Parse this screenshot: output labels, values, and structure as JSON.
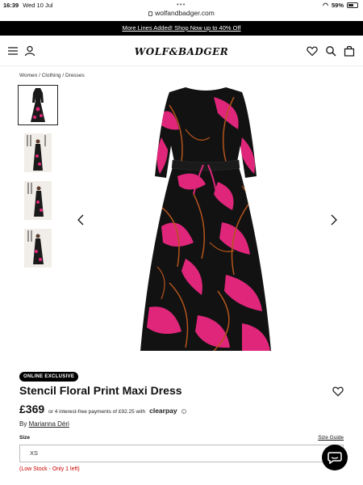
{
  "status_bar": {
    "time": "16:39",
    "date": "Wed 10 Jul",
    "url": "wolfandbadger.com",
    "battery": "59%",
    "battery_level": 0.59
  },
  "promo": {
    "text": "More Lines Added! Shop Now up to 40% Off"
  },
  "header": {
    "logo": "WOLF&BADGER"
  },
  "breadcrumb": "Women / Clothing / Dresses",
  "product": {
    "badge": "ONLINE EXCLUSIVE",
    "title": "Stencil Floral Print Maxi Dress",
    "price": "£369",
    "installments": "or 4 interest-free payments of £92.25 with",
    "clearpay": "clearpay",
    "by_prefix": "By",
    "designer": "Marianna Déri",
    "size_label": "Size",
    "size_guide": "Size Guide",
    "size_selected": "XS",
    "stock": "(Low Stock - Only 1 left)"
  },
  "colors": {
    "accent": "#000000",
    "dress_pink": "#e0267a",
    "dress_orange": "#b5541c",
    "stock_red": "#cc0000"
  }
}
